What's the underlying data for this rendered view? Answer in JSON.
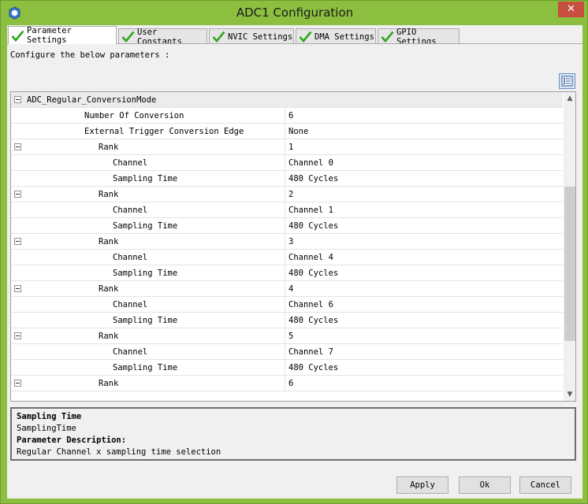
{
  "window": {
    "title": "ADC1 Configuration",
    "close_glyph": "✕"
  },
  "tabs": [
    {
      "label": "Parameter Settings",
      "active": true
    },
    {
      "label": "User Constants",
      "active": false
    },
    {
      "label": "NVIC Settings",
      "active": false
    },
    {
      "label": "DMA Settings",
      "active": false
    },
    {
      "label": "GPIO Settings",
      "active": false
    }
  ],
  "panel": {
    "intro": "Configure the below parameters :"
  },
  "grid": {
    "rows": [
      {
        "name": "ADC_Regular_ConversionMode",
        "value": "",
        "group": true,
        "toggle": true
      },
      {
        "name": "Number Of Conversion",
        "value": "6"
      },
      {
        "name": "External Trigger Conversion Edge",
        "value": "None"
      },
      {
        "name": "Rank",
        "value": "1",
        "toggle": true
      },
      {
        "name": "Channel",
        "value": "Channel 0"
      },
      {
        "name": "Sampling Time",
        "value": "480 Cycles"
      },
      {
        "name": "Rank",
        "value": "2",
        "toggle": true
      },
      {
        "name": "Channel",
        "value": "Channel 1"
      },
      {
        "name": "Sampling Time",
        "value": "480 Cycles"
      },
      {
        "name": "Rank",
        "value": "3",
        "toggle": true
      },
      {
        "name": "Channel",
        "value": "Channel 4"
      },
      {
        "name": "Sampling Time",
        "value": "480 Cycles"
      },
      {
        "name": "Rank",
        "value": "4",
        "toggle": true
      },
      {
        "name": "Channel",
        "value": "Channel 6"
      },
      {
        "name": "Sampling Time",
        "value": "480 Cycles"
      },
      {
        "name": "Rank",
        "value": "5",
        "toggle": true
      },
      {
        "name": "Channel",
        "value": "Channel 7"
      },
      {
        "name": "Sampling Time",
        "value": "480 Cycles"
      },
      {
        "name": "Rank",
        "value": "6",
        "toggle": true
      }
    ]
  },
  "description": {
    "title": "Sampling Time",
    "param_name": "SamplingTime",
    "desc_heading": "Parameter Description:",
    "desc_text": "Regular Channel x sampling time selection"
  },
  "buttons": {
    "apply": "Apply",
    "ok": "Ok",
    "cancel": "Cancel"
  },
  "colors": {
    "frame": "#8cbf3f",
    "check": "#2fa51d",
    "close": "#c74f3f"
  }
}
